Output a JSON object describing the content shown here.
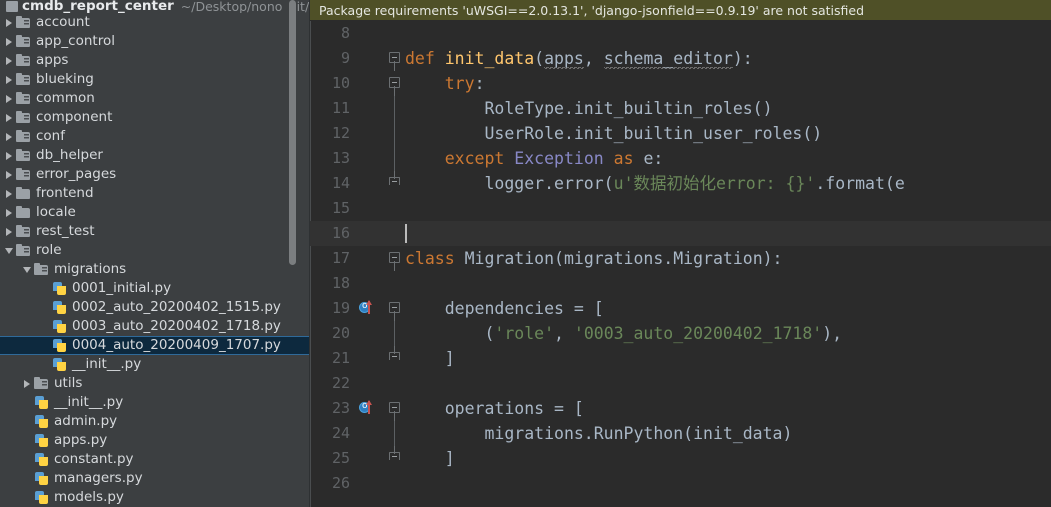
{
  "project": {
    "name": "cmdb_report_center",
    "path": "~/Desktop/nono_git/cm"
  },
  "sidebar": {
    "items": [
      {
        "label": "account",
        "type": "folder-module",
        "indent": 0,
        "expanded": false,
        "selected": false
      },
      {
        "label": "app_control",
        "type": "folder-module",
        "indent": 0,
        "expanded": false,
        "selected": false
      },
      {
        "label": "apps",
        "type": "folder-module",
        "indent": 0,
        "expanded": false,
        "selected": false
      },
      {
        "label": "blueking",
        "type": "folder-module",
        "indent": 0,
        "expanded": false,
        "selected": false
      },
      {
        "label": "common",
        "type": "folder-module",
        "indent": 0,
        "expanded": false,
        "selected": false
      },
      {
        "label": "component",
        "type": "folder-module",
        "indent": 0,
        "expanded": false,
        "selected": false
      },
      {
        "label": "conf",
        "type": "folder-module",
        "indent": 0,
        "expanded": false,
        "selected": false
      },
      {
        "label": "db_helper",
        "type": "folder-module",
        "indent": 0,
        "expanded": false,
        "selected": false
      },
      {
        "label": "error_pages",
        "type": "folder-module",
        "indent": 0,
        "expanded": false,
        "selected": false
      },
      {
        "label": "frontend",
        "type": "folder",
        "indent": 0,
        "expanded": false,
        "selected": false
      },
      {
        "label": "locale",
        "type": "folder",
        "indent": 0,
        "expanded": false,
        "selected": false
      },
      {
        "label": "rest_test",
        "type": "folder-module",
        "indent": 0,
        "expanded": false,
        "selected": false
      },
      {
        "label": "role",
        "type": "folder-module",
        "indent": 0,
        "expanded": true,
        "selected": false
      },
      {
        "label": "migrations",
        "type": "folder-module",
        "indent": 1,
        "expanded": true,
        "selected": false
      },
      {
        "label": "0001_initial.py",
        "type": "python",
        "indent": 2,
        "expanded": null,
        "selected": false
      },
      {
        "label": "0002_auto_20200402_1515.py",
        "type": "python",
        "indent": 2,
        "expanded": null,
        "selected": false
      },
      {
        "label": "0003_auto_20200402_1718.py",
        "type": "python",
        "indent": 2,
        "expanded": null,
        "selected": false
      },
      {
        "label": "0004_auto_20200409_1707.py",
        "type": "python",
        "indent": 2,
        "expanded": null,
        "selected": true
      },
      {
        "label": "__init__.py",
        "type": "python",
        "indent": 2,
        "expanded": null,
        "selected": false
      },
      {
        "label": "utils",
        "type": "folder-module",
        "indent": 1,
        "expanded": false,
        "selected": false
      },
      {
        "label": "__init__.py",
        "type": "python",
        "indent": 1,
        "expanded": null,
        "selected": false
      },
      {
        "label": "admin.py",
        "type": "python",
        "indent": 1,
        "expanded": null,
        "selected": false
      },
      {
        "label": "apps.py",
        "type": "python",
        "indent": 1,
        "expanded": null,
        "selected": false
      },
      {
        "label": "constant.py",
        "type": "python",
        "indent": 1,
        "expanded": null,
        "selected": false
      },
      {
        "label": "managers.py",
        "type": "python",
        "indent": 1,
        "expanded": null,
        "selected": false
      },
      {
        "label": "models.py",
        "type": "python",
        "indent": 1,
        "expanded": null,
        "selected": false
      }
    ]
  },
  "notification": {
    "text": "Package requirements 'uWSGI==2.0.13.1', 'django-jsonfield==0.9.19' are not satisfied",
    "background": "#4f5027"
  },
  "editor": {
    "lines": [
      {
        "num": "8",
        "marker": null,
        "fold": null,
        "current": false,
        "tokens": []
      },
      {
        "num": "9",
        "marker": null,
        "fold": "start",
        "current": false,
        "tokens": [
          {
            "t": "def ",
            "c": "kw"
          },
          {
            "t": "init_data",
            "c": "fn"
          },
          {
            "t": "(",
            "c": "plain"
          },
          {
            "t": "apps",
            "c": "wavy"
          },
          {
            "t": ", ",
            "c": "plain"
          },
          {
            "t": "schema_editor",
            "c": "wavy"
          },
          {
            "t": "):",
            "c": "plain"
          }
        ]
      },
      {
        "num": "10",
        "marker": null,
        "fold": "start",
        "current": false,
        "tokens": [
          {
            "t": "    ",
            "c": "plain"
          },
          {
            "t": "try",
            "c": "kw"
          },
          {
            "t": ":",
            "c": "plain"
          }
        ]
      },
      {
        "num": "11",
        "marker": null,
        "fold": "line",
        "current": false,
        "tokens": [
          {
            "t": "        RoleType.init_builtin_roles()",
            "c": "plain"
          }
        ]
      },
      {
        "num": "12",
        "marker": null,
        "fold": "line",
        "current": false,
        "tokens": [
          {
            "t": "        UserRole.init_builtin_user_roles()",
            "c": "plain"
          }
        ]
      },
      {
        "num": "13",
        "marker": null,
        "fold": "line",
        "current": false,
        "tokens": [
          {
            "t": "    ",
            "c": "plain"
          },
          {
            "t": "except ",
            "c": "kw"
          },
          {
            "t": "Exception",
            "c": "cls"
          },
          {
            "t": " ",
            "c": "plain"
          },
          {
            "t": "as",
            "c": "kw"
          },
          {
            "t": " e:",
            "c": "plain"
          }
        ]
      },
      {
        "num": "14",
        "marker": null,
        "fold": "end",
        "current": false,
        "tokens": [
          {
            "t": "        logger.error(",
            "c": "plain"
          },
          {
            "t": "u",
            "c": "pfx"
          },
          {
            "t": "'数据初始化error: {}'",
            "c": "str"
          },
          {
            "t": ".format(e",
            "c": "plain"
          }
        ]
      },
      {
        "num": "15",
        "marker": null,
        "fold": null,
        "current": false,
        "tokens": []
      },
      {
        "num": "16",
        "marker": null,
        "fold": null,
        "current": true,
        "tokens": [],
        "caret": true
      },
      {
        "num": "17",
        "marker": null,
        "fold": "start",
        "current": false,
        "tokens": [
          {
            "t": "class ",
            "c": "kw"
          },
          {
            "t": "Migration",
            "c": "plain"
          },
          {
            "t": "(migrations.Migration):",
            "c": "plain"
          }
        ]
      },
      {
        "num": "18",
        "marker": null,
        "fold": null,
        "current": false,
        "tokens": []
      },
      {
        "num": "19",
        "marker": "override",
        "fold": "start",
        "current": false,
        "tokens": [
          {
            "t": "    dependencies = [",
            "c": "plain"
          }
        ]
      },
      {
        "num": "20",
        "marker": null,
        "fold": "line",
        "current": false,
        "tokens": [
          {
            "t": "        (",
            "c": "plain"
          },
          {
            "t": "'role'",
            "c": "str"
          },
          {
            "t": ", ",
            "c": "plain"
          },
          {
            "t": "'0003_auto_20200402_1718'",
            "c": "str"
          },
          {
            "t": "),",
            "c": "plain"
          }
        ]
      },
      {
        "num": "21",
        "marker": null,
        "fold": "end",
        "current": false,
        "tokens": [
          {
            "t": "    ]",
            "c": "plain"
          }
        ]
      },
      {
        "num": "22",
        "marker": null,
        "fold": null,
        "current": false,
        "tokens": []
      },
      {
        "num": "23",
        "marker": "override",
        "fold": "start",
        "current": false,
        "tokens": [
          {
            "t": "    operations = [",
            "c": "plain"
          }
        ]
      },
      {
        "num": "24",
        "marker": null,
        "fold": "line",
        "current": false,
        "tokens": [
          {
            "t": "        migrations.RunPython(init_data)",
            "c": "plain"
          }
        ]
      },
      {
        "num": "25",
        "marker": null,
        "fold": "end",
        "current": false,
        "tokens": [
          {
            "t": "    ]",
            "c": "plain"
          }
        ]
      },
      {
        "num": "26",
        "marker": null,
        "fold": null,
        "current": false,
        "tokens": []
      }
    ]
  },
  "colors": {
    "sidebar_bg": "#3c3f41",
    "editor_bg": "#2b2b2b",
    "selection_bg": "#0d293e",
    "keyword": "#cc7832",
    "function": "#ffc66d",
    "string": "#6a8759",
    "class": "#8888c6",
    "text": "#a9b7c6",
    "line_number": "#606366",
    "notification_bg": "#4f5027",
    "marker_blue": "#2f7fc1",
    "marker_red": "#c75450"
  }
}
